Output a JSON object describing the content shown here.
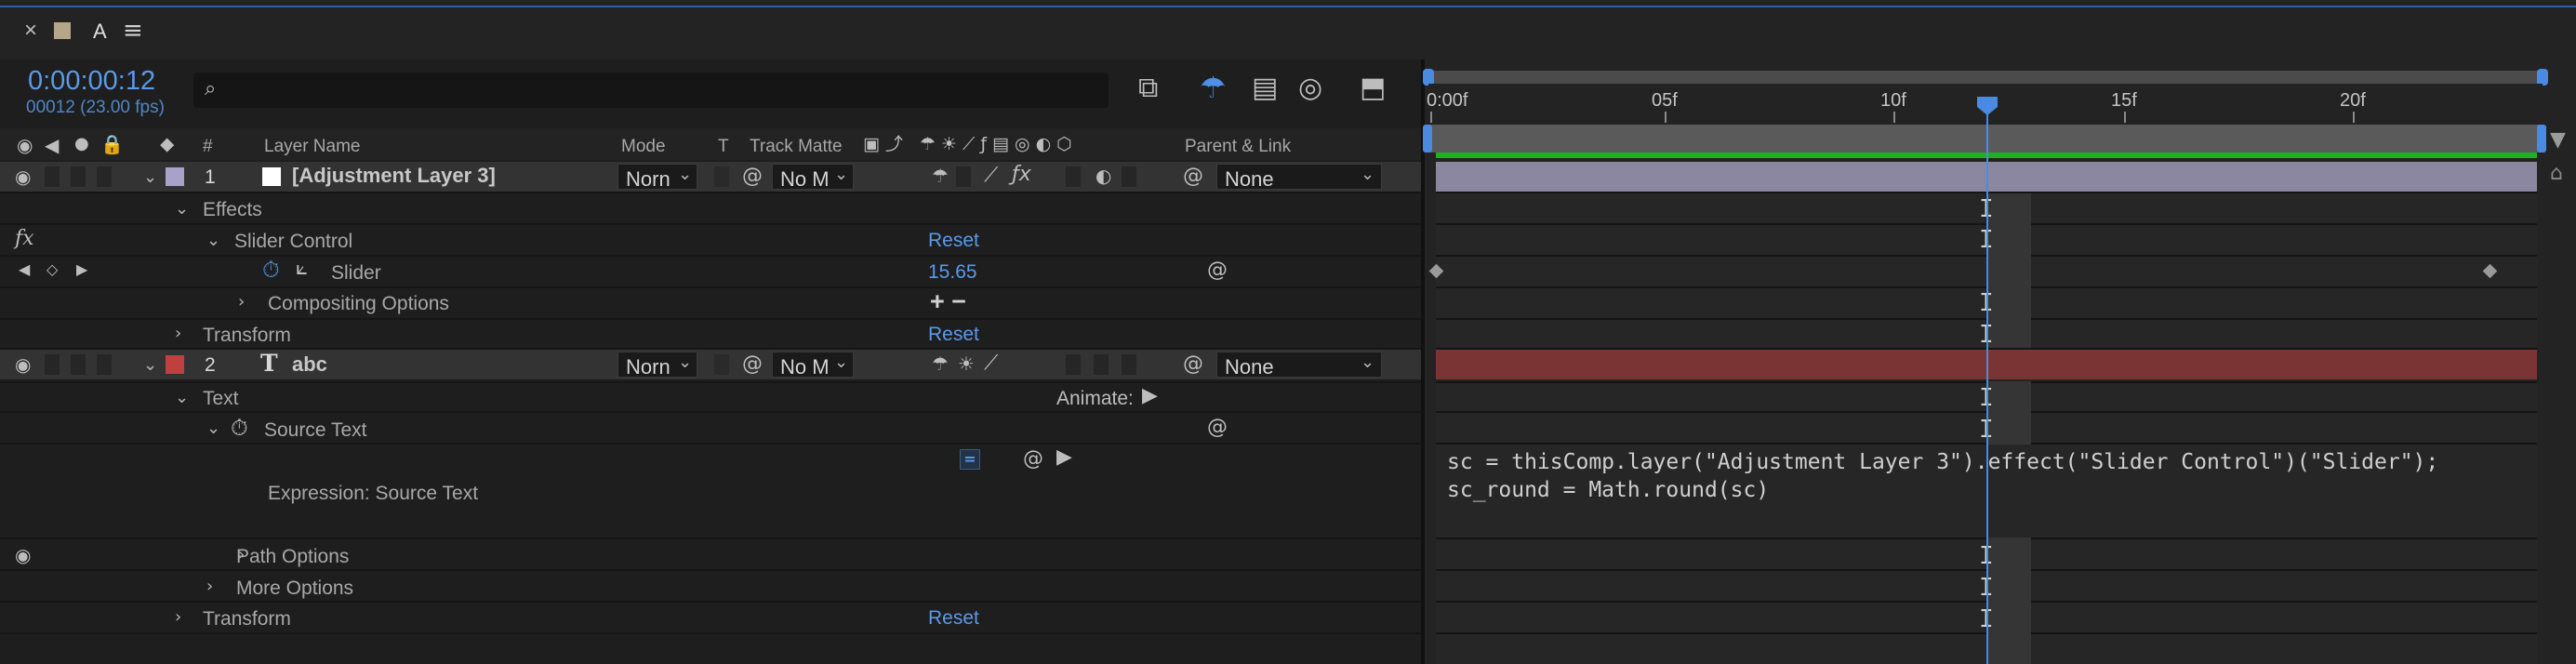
{
  "tab_bar": {
    "close_label": "×",
    "panel_letter": "A",
    "menu_label": "≡"
  },
  "header": {
    "timecode": "0:00:00:12",
    "frame_info": "00012 (23.00 fps)",
    "search": {
      "value": "",
      "placeholder": ""
    }
  },
  "columns": {
    "hash": "#",
    "layer_name": "Layer Name",
    "mode": "Mode",
    "t": "T",
    "track_matte": "Track Matte",
    "parent_link": "Parent & Link"
  },
  "ruler": {
    "labels": [
      "0:00f",
      "05f",
      "10f",
      "15f",
      "20f"
    ]
  },
  "layers": [
    {
      "number": "1",
      "name": "[Adjustment Layer 3]",
      "label_color": "#a8a2c8",
      "mode": "Norn",
      "track_matte": "No M",
      "parent": "None",
      "bar_color": "#8c87a0"
    },
    {
      "number": "2",
      "type_icon": "T",
      "name": "abc",
      "label_color": "#c0403f",
      "mode": "Norn",
      "track_matte": "No M",
      "parent": "None",
      "bar_color": "#7a3434"
    }
  ],
  "properties": {
    "effects": "Effects",
    "slider_control": "Slider Control",
    "slider_control_reset": "Reset",
    "slider": "Slider",
    "slider_value": "15.65",
    "compositing_options": "Compositing Options",
    "compositing_plus_minus": "+ −",
    "transform_1": "Transform",
    "transform_1_reset": "Reset",
    "text": "Text",
    "animate_label": "Animate:",
    "source_text": "Source Text",
    "expression_label": "Expression: Source Text",
    "expression_equals": "=",
    "path_options": "Path Options",
    "more_options": "More Options",
    "transform_2": "Transform",
    "transform_2_reset": "Reset"
  },
  "expression": {
    "line1": "sc = thisComp.layer(\"Adjustment Layer 3\").effect(\"Slider Control\")(\"Slider\");",
    "line2": "sc_round = Math.round(sc)"
  },
  "ibeam_glyph": "I",
  "colors": {
    "accent": "#5a9ae8",
    "work_area_green": "#1db21d",
    "playhead": "#4a8ae0"
  }
}
